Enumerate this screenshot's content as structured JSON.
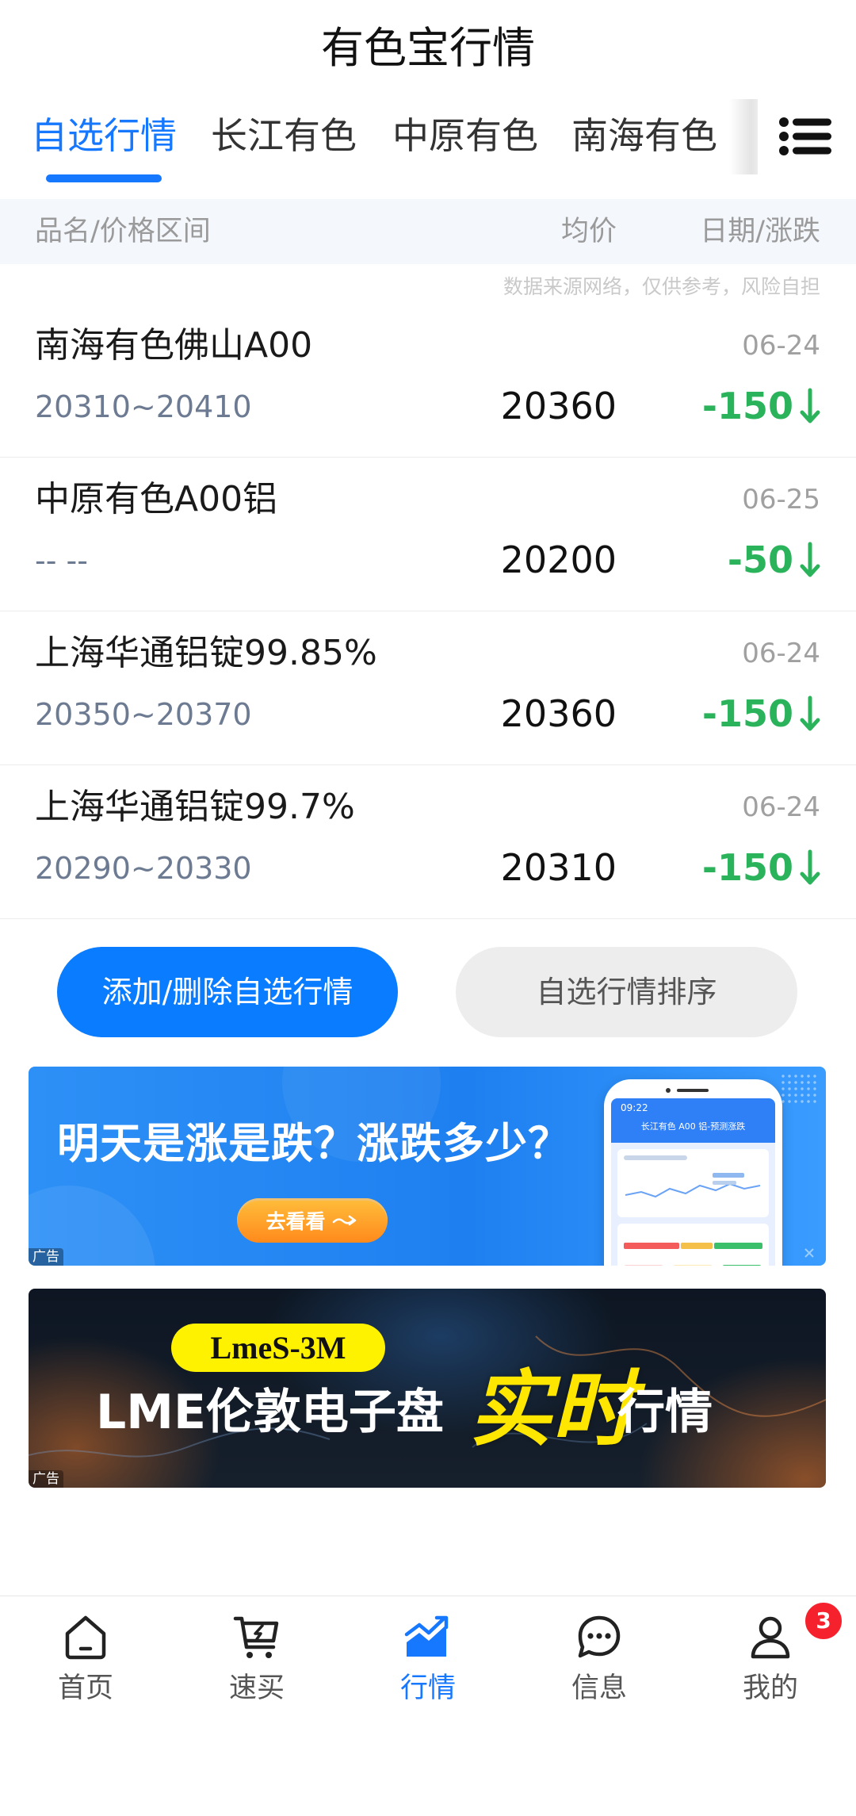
{
  "header": {
    "title": "有色宝行情"
  },
  "tabs": [
    {
      "label": "自选行情",
      "active": true
    },
    {
      "label": "长江有色",
      "active": false
    },
    {
      "label": "中原有色",
      "active": false
    },
    {
      "label": "南海有色",
      "active": false
    }
  ],
  "table_header": {
    "name_range": "品名/价格区间",
    "avg": "均价",
    "date_change": "日期/涨跌"
  },
  "disclaimer": "数据来源网络，仅供参考，风险自担",
  "quotes": [
    {
      "name": "南海有色佛山A00",
      "range": "20310~20410",
      "avg": "20360",
      "date": "06-24",
      "change": "-150",
      "direction": "down"
    },
    {
      "name": "中原有色A00铝",
      "range": "-- --",
      "avg": "20200",
      "date": "06-25",
      "change": "-50",
      "direction": "down"
    },
    {
      "name": "上海华通铝锭99.85%",
      "range": "20350~20370",
      "avg": "20360",
      "date": "06-24",
      "change": "-150",
      "direction": "down"
    },
    {
      "name": "上海华通铝锭99.7%",
      "range": "20290~20330",
      "avg": "20310",
      "date": "06-24",
      "change": "-150",
      "direction": "down"
    }
  ],
  "actions": {
    "edit_label": "添加/删除自选行情",
    "sort_label": "自选行情排序"
  },
  "ads": {
    "forecast": {
      "headline": "明天是涨是跌？涨跌多少？",
      "cta": "去看看",
      "tag": "广告",
      "phone_time": "09:22",
      "phone_title": "长江有色 A00 铝-预测涨跌"
    },
    "lme": {
      "badge": "LmeS-3M",
      "headline_prefix": "LME伦敦电子盘",
      "highlight": "实时",
      "headline_suffix": "行情",
      "tag": "广告"
    }
  },
  "nav": [
    {
      "label": "首页",
      "icon": "home-icon",
      "active": false
    },
    {
      "label": "速买",
      "icon": "cart-icon",
      "active": false
    },
    {
      "label": "行情",
      "icon": "chart-icon",
      "active": true
    },
    {
      "label": "信息",
      "icon": "chat-icon",
      "active": false
    },
    {
      "label": "我的",
      "icon": "user-icon",
      "active": false,
      "badge": "3"
    }
  ],
  "colors": {
    "accent": "#1677ff",
    "down": "#2bb35b",
    "range_text": "#6c7a92",
    "badge": "#f5222d",
    "highlight_yellow": "#ffe600"
  }
}
